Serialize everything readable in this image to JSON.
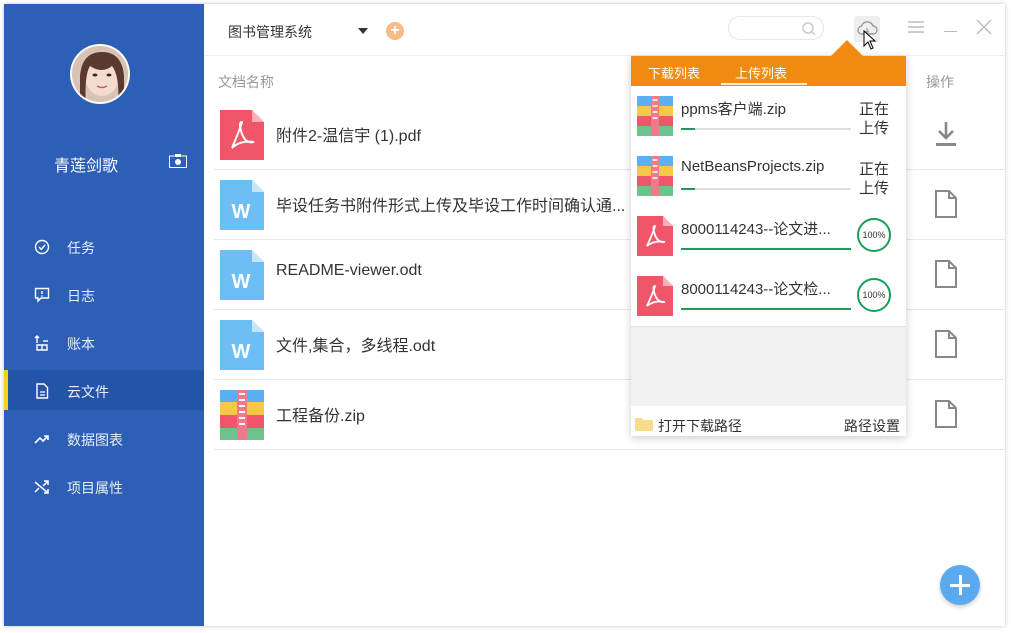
{
  "sidebar": {
    "username": "青莲剑歌",
    "items": [
      {
        "label": "任务",
        "icon": "check-circle-icon"
      },
      {
        "label": "日志",
        "icon": "comment-icon"
      },
      {
        "label": "账本",
        "icon": "ledger-icon"
      },
      {
        "label": "云文件",
        "icon": "file-icon",
        "active": true
      },
      {
        "label": "数据图表",
        "icon": "trend-icon"
      },
      {
        "label": "项目属性",
        "icon": "shuffle-icon"
      }
    ],
    "accent": "#2c5fb5",
    "active_marker": "#f5d21a"
  },
  "topbar": {
    "title": "图书管理系统",
    "search": {
      "placeholder": ""
    }
  },
  "file_list": {
    "header_name": "文档名称",
    "header_ops": "操作",
    "files": [
      {
        "name": "附件2-温信宇 (1).pdf",
        "type": "pdf",
        "op": "download-icon"
      },
      {
        "name": "毕设任务书附件形式上传及毕设工作时间确认通...",
        "type": "word",
        "op": "document-icon"
      },
      {
        "name": "README-viewer.odt",
        "type": "word",
        "op": "document-icon"
      },
      {
        "name": "文件,集合，多线程.odt",
        "type": "word",
        "op": "document-icon"
      },
      {
        "name": "工程备份.zip",
        "type": "zip",
        "op": "document-icon"
      }
    ]
  },
  "transfer_panel": {
    "tabs": [
      "下载列表",
      "上传列表"
    ],
    "active_tab": "上传列表",
    "items": [
      {
        "name": "ppms客户端.zip",
        "type": "zip",
        "status": "正在上传",
        "progress": 0.08
      },
      {
        "name": "NetBeansProjects.zip",
        "type": "zip",
        "status": "正在上传",
        "progress": 0.08
      },
      {
        "name": "8000114243--论文进...",
        "type": "pdf",
        "status": "100%",
        "progress": 1.0
      },
      {
        "name": "8000114243--论文检...",
        "type": "pdf",
        "status": "100%",
        "progress": 1.0
      }
    ],
    "open_path_label": "打开下载路径",
    "path_settings_label": "路径设置",
    "accent": "#f08b11"
  }
}
